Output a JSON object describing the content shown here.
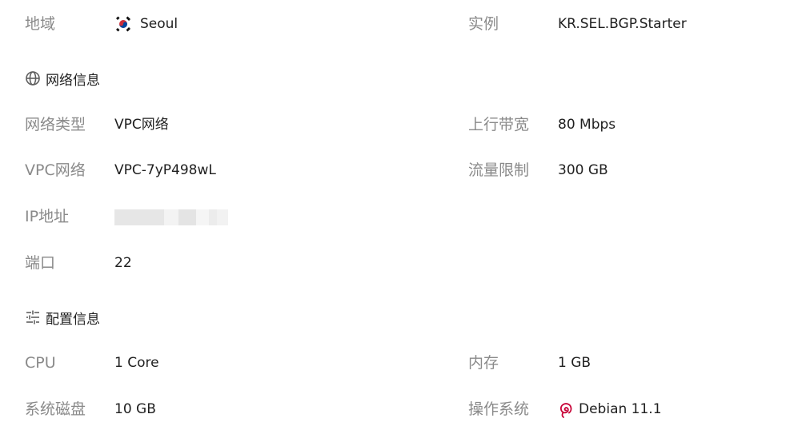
{
  "region": {
    "label": "地域",
    "value": "Seoul",
    "flag_icon": "south-korea-flag-icon"
  },
  "instance": {
    "label": "实例",
    "value": "KR.SEL.BGP.Starter"
  },
  "network_section": {
    "title": "网络信息",
    "icon": "globe-icon"
  },
  "network": {
    "type": {
      "label": "网络类型",
      "value": "VPC网络"
    },
    "bandwidth": {
      "label": "上行带宽",
      "value": "80 Mbps"
    },
    "vpc": {
      "label": "VPC网络",
      "value": "VPC-7yP498wL"
    },
    "traffic": {
      "label": "流量限制",
      "value": "300 GB"
    },
    "ip": {
      "label": "IP地址",
      "value": ""
    },
    "port": {
      "label": "端口",
      "value": "22"
    }
  },
  "config_section": {
    "title": "配置信息",
    "icon": "sliders-icon"
  },
  "config": {
    "cpu": {
      "label": "CPU",
      "value": "1 Core"
    },
    "memory": {
      "label": "内存",
      "value": "1 GB"
    },
    "disk": {
      "label": "系统磁盘",
      "value": "10 GB"
    },
    "os": {
      "label": "操作系统",
      "value": "Debian 11.1",
      "icon": "debian-logo-icon"
    }
  },
  "colors": {
    "label": "#8a8a8a",
    "value": "#1f1f1f",
    "debian": "#c70036"
  }
}
